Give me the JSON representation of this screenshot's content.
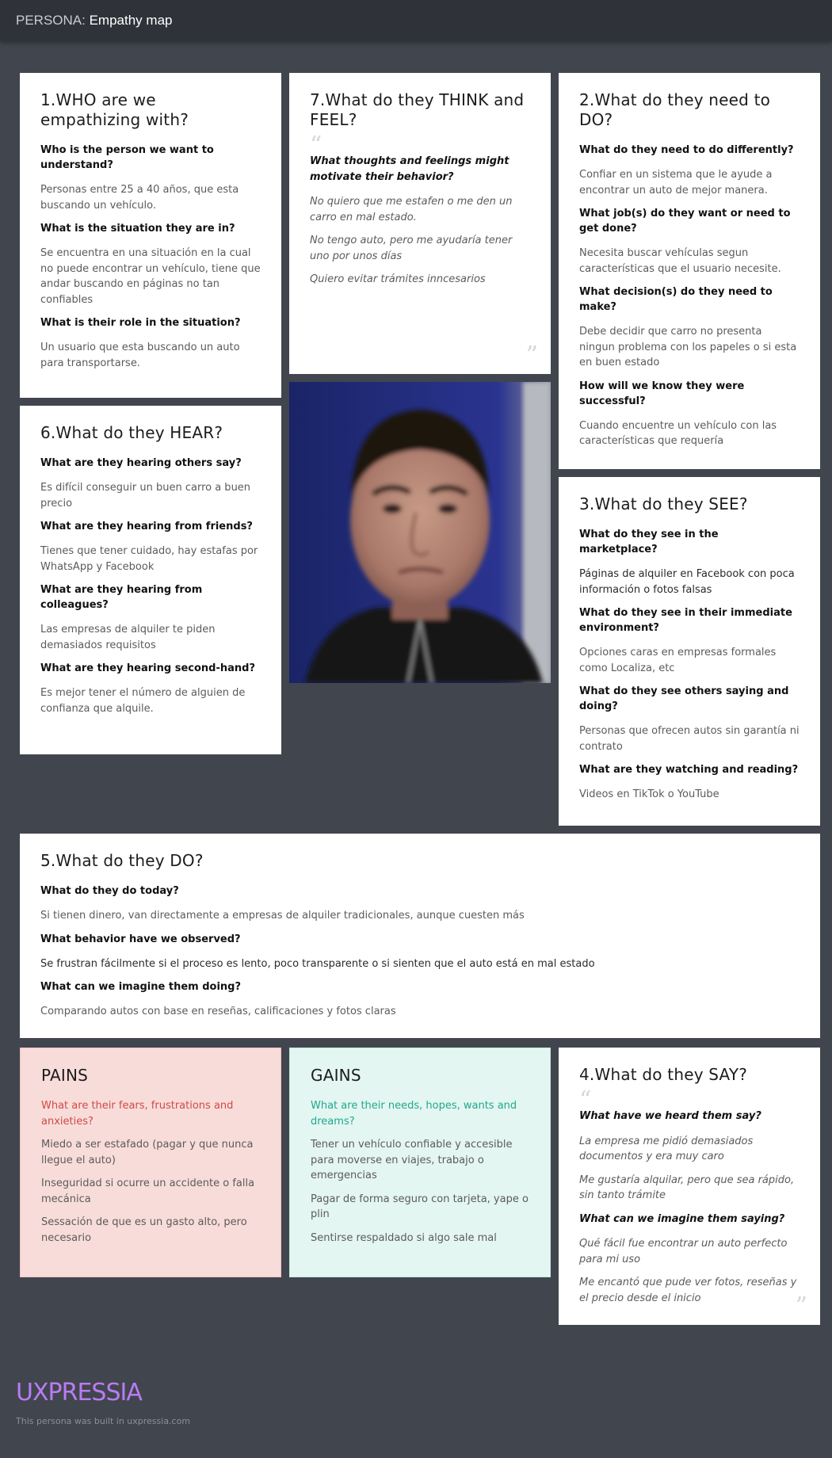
{
  "header": {
    "prefix": "PERSONA:",
    "title": "Empathy map"
  },
  "who": {
    "title": "1.WHO are we empathizing with?",
    "items": [
      {
        "q": "Who is the person we want to understand?",
        "a": "Personas entre 25 a 40 años, que esta buscando un vehículo."
      },
      {
        "q": "What is the situation they are in?",
        "a": "Se encuentra en una situación en la cual no puede encontrar un vehículo, tiene que andar buscando en páginas no tan confiables"
      },
      {
        "q": "What is their role in the situation?",
        "a": "Un usuario que esta buscando un auto para transportarse."
      }
    ]
  },
  "think": {
    "title": "7.What do they THINK and FEEL?",
    "question": "What thoughts and feelings might motivate their behavior?",
    "answers": [
      "No quiero que me estafen o me den un carro en mal estado.",
      "No tengo auto, pero me ayudaría tener uno por unos días",
      "Quiero evitar trámites inncesarios"
    ]
  },
  "do_need": {
    "title": "2.What do they need to DO?",
    "items": [
      {
        "q": "What do they need to do differently?",
        "a": "Confiar en un sistema que le ayude a encontrar un auto de mejor manera."
      },
      {
        "q": "What job(s) do they want or need to get done?",
        "a": "Necesita buscar vehículas segun características que el usuario necesite."
      },
      {
        "q": "What decision(s) do they need to make?",
        "a": "Debe decidir que carro no presenta ningun problema con los papeles o si esta en buen estado"
      },
      {
        "q": "How will we know they were successful?",
        "a": "Cuando encuentre un vehículo con las características que requería"
      }
    ]
  },
  "hear": {
    "title": "6.What do they HEAR?",
    "items": [
      {
        "q": "What are they hearing others say?",
        "a": "Es difícil conseguir un buen carro a buen precio"
      },
      {
        "q": "What are they hearing from friends?",
        "a": "Tienes que tener cuidado, hay estafas por WhatsApp y Facebook"
      },
      {
        "q": "What are they hearing  from colleagues?",
        "a": "Las empresas de alquiler te piden demasiados requisitos"
      },
      {
        "q": "What are they hearing second-hand?",
        "a": "Es mejor tener el número de alguien de confianza que alquile."
      }
    ]
  },
  "see": {
    "title": "3.What do they SEE?",
    "items": [
      {
        "q": "What do they see in the marketplace?",
        "a": "Páginas de alquiler en Facebook con poca información o fotos falsas"
      },
      {
        "q": "What do they see in their immediate environment?",
        "a": "Opciones caras en empresas formales como Localiza, etc"
      },
      {
        "q": "What do they see others saying and doing?",
        "a": "Personas que ofrecen autos sin garantía ni contrato"
      },
      {
        "q": "What are they watching and reading?",
        "a": "Videos en TikTok o YouTube"
      }
    ]
  },
  "do_now": {
    "title": "5.What do they DO?",
    "items": [
      {
        "q": "What do they do today?",
        "a": "Si tienen dinero, van directamente a empresas de alquiler tradicionales, aunque cuesten más"
      },
      {
        "q": "What behavior have we observed?",
        "a": "Se frustran fácilmente si el proceso es lento, poco transparente o si sienten que el auto está en mal estado"
      },
      {
        "q": "What can we imagine them doing?",
        "a": "Comparando autos con base en reseñas, calificaciones y fotos claras"
      }
    ]
  },
  "pains": {
    "title": "PAINS",
    "lead": "What are their fears, frustrations and anxieties?",
    "items": [
      "Miedo a ser estafado (pagar y que nunca llegue el auto)",
      "Inseguridad si ocurre un accidente o falla mecánica",
      "Sessación de que es un gasto alto, pero necesario"
    ]
  },
  "gains": {
    "title": "GAINS",
    "lead": "What are their needs, hopes, wants and dreams?",
    "items": [
      "Tener un vehículo confiable y accesible para moverse en viajes, trabajo o emergencias",
      "Pagar de forma seguro con tarjeta, yape o plin",
      "Sentirse respaldado si algo sale mal"
    ]
  },
  "say": {
    "title": "4.What do they SAY?",
    "q1": "What have we heard them say?",
    "answers1": [
      "La empresa me pidió demasiados documentos y era muy caro",
      "Me gustaría alquilar, pero que sea rápido, sin tanto trámite"
    ],
    "q2": "What can we imagine them saying?",
    "answers2": [
      "Qué fácil fue encontrar un auto perfecto para mi uso",
      "Me encantó que pude ver  fotos, reseñas y el precio desde el inicio"
    ]
  },
  "footer": {
    "logo": "UXPRESSIA",
    "credit": "This persona was built in uxpressia.com"
  },
  "colors": {
    "background": "#41454e",
    "pains_bg": "#f8dcda",
    "pains_accent": "#cf4a44",
    "gains_bg": "#e3f6f1",
    "gains_accent": "#21a88d",
    "logo": "#b97cf2"
  }
}
